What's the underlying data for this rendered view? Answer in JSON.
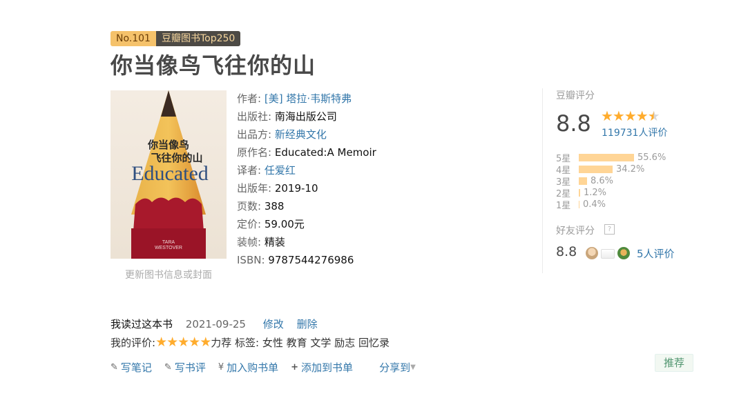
{
  "badge": {
    "rank": "No.101",
    "list": "豆瓣图书Top250"
  },
  "book": {
    "title": "你当像鸟飞往你的山",
    "cover_text": {
      "cn_title_1": "你当像鸟",
      "cn_title_2": "飞往你的山",
      "en_title": "Educated",
      "author_en_1": "TARA",
      "author_en_2": "WESTOVER"
    },
    "update_cover": "更新图书信息或封面",
    "info": {
      "author_label": "作者:",
      "author": "[美] 塔拉·韦斯特弗",
      "publisher_label": "出版社:",
      "publisher": "南海出版公司",
      "producer_label": "出品方:",
      "producer": "新经典文化",
      "original_label": "原作名:",
      "original": "Educated:A Memoir",
      "translator_label": "译者:",
      "translator": "任爱红",
      "year_label": "出版年:",
      "year": "2019-10",
      "pages_label": "页数:",
      "pages": "388",
      "price_label": "定价:",
      "price": "59.00元",
      "binding_label": "装帧:",
      "binding": "精装",
      "isbn_label": "ISBN:",
      "isbn": "9787544276986"
    }
  },
  "rating": {
    "label": "豆瓣评分",
    "score": "8.8",
    "stars": "★★★★★",
    "votes": "119731人评价",
    "distribution": [
      {
        "label": "5星",
        "pct": "55.6%",
        "value": 55.6
      },
      {
        "label": "4星",
        "pct": "34.2%",
        "value": 34.2
      },
      {
        "label": "3星",
        "pct": "8.6%",
        "value": 8.6
      },
      {
        "label": "2星",
        "pct": "1.2%",
        "value": 1.2
      },
      {
        "label": "1星",
        "pct": "0.4%",
        "value": 0.4
      }
    ],
    "friend_label": "好友评分",
    "friend_help": "?",
    "friend_score": "8.8",
    "friend_votes": "5人评价"
  },
  "user": {
    "read_status": "我读过这本书",
    "read_date": "2021-09-25",
    "edit": "修改",
    "delete": "删除",
    "my_rating_label": "我的评价:",
    "my_stars": "★★★★★",
    "my_rating_word": "力荐",
    "tags_label": "标签:",
    "tags": "女性 教育 文学 励志 回忆录"
  },
  "actions": {
    "write_note": "写笔记",
    "write_review": "写书评",
    "add_cart": "加入购书单",
    "add_list": "添加到书单",
    "share": "分享到",
    "recommend": "推荐"
  },
  "colors": {
    "link": "#3377aa",
    "star": "#ffac2d",
    "bar": "#ffd596"
  }
}
